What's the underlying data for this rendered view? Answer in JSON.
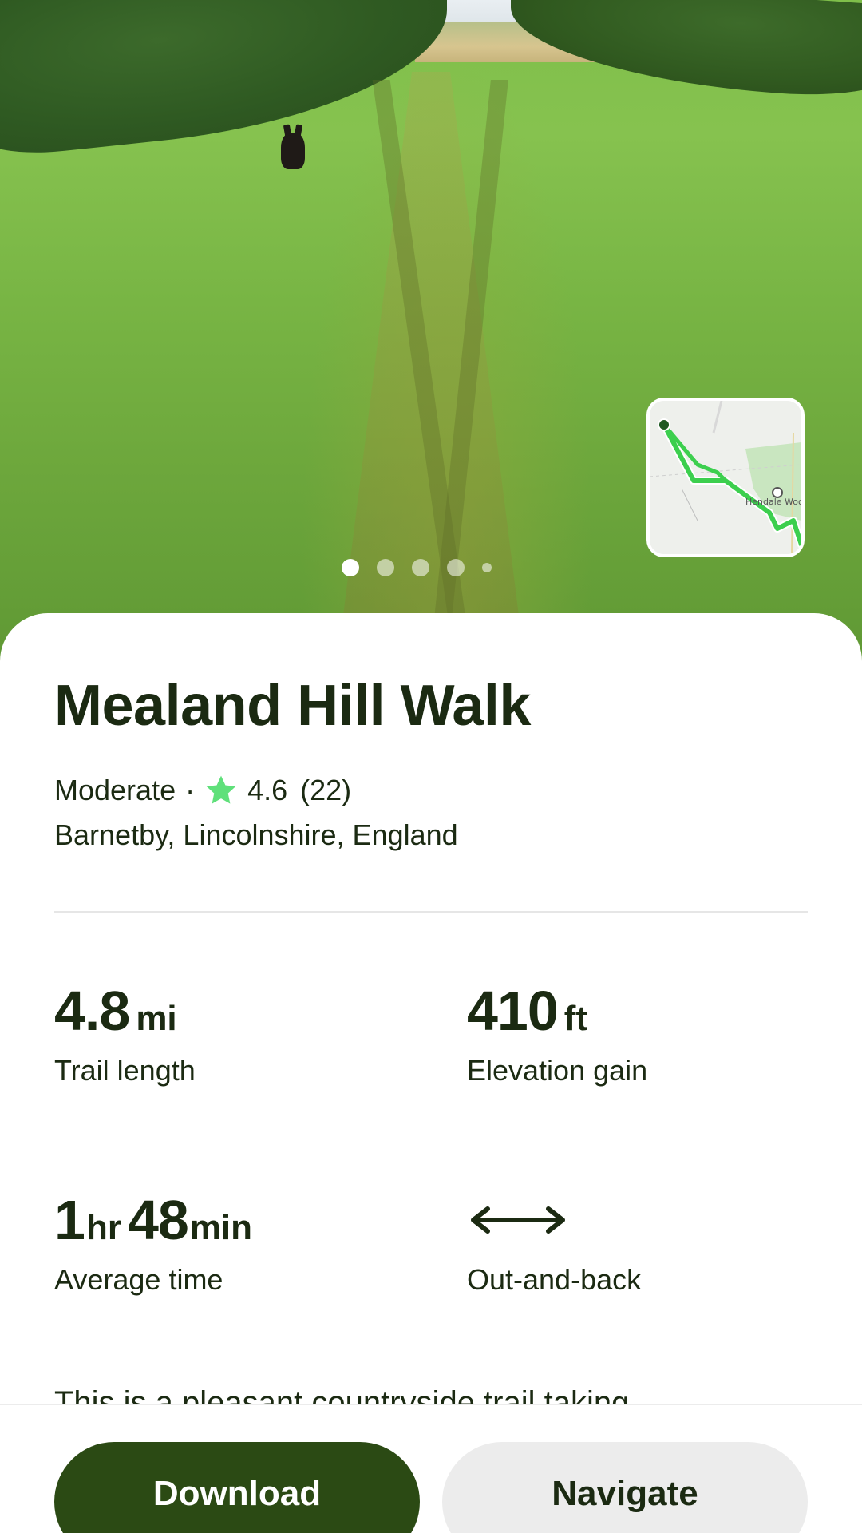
{
  "carousel": {
    "total_photos": 5,
    "active_index": 0
  },
  "map_preview": {
    "place_label": "Hendale Woo"
  },
  "trail": {
    "name": "Mealand Hill Walk",
    "difficulty": "Moderate",
    "separator": "·",
    "rating": "4.6",
    "review_count": "(22)",
    "location": "Barnetby, Lincolnshire, England"
  },
  "stats": {
    "length": {
      "value": "4.8",
      "unit": "mi",
      "label": "Trail length"
    },
    "elevation": {
      "value": "410",
      "unit": "ft",
      "label": "Elevation gain"
    },
    "time": {
      "hours": "1",
      "hours_unit": "hr",
      "minutes": "48",
      "minutes_unit": "min",
      "label": "Average time"
    },
    "route_type": {
      "label": "Out-and-back",
      "icon": "double-arrow-icon"
    }
  },
  "description": {
    "text": "This is a pleasant countryside trail taking"
  },
  "actions": {
    "download_label": "Download",
    "navigate_label": "Navigate"
  },
  "colors": {
    "primary_green": "#2b4a14",
    "text_dark": "#1b2a12",
    "star": "#5fe07a",
    "route_line": "#3ccf4e",
    "secondary_button": "#ececec"
  },
  "icons": {
    "rating": "star-icon",
    "route_type": "double-arrow-icon"
  }
}
